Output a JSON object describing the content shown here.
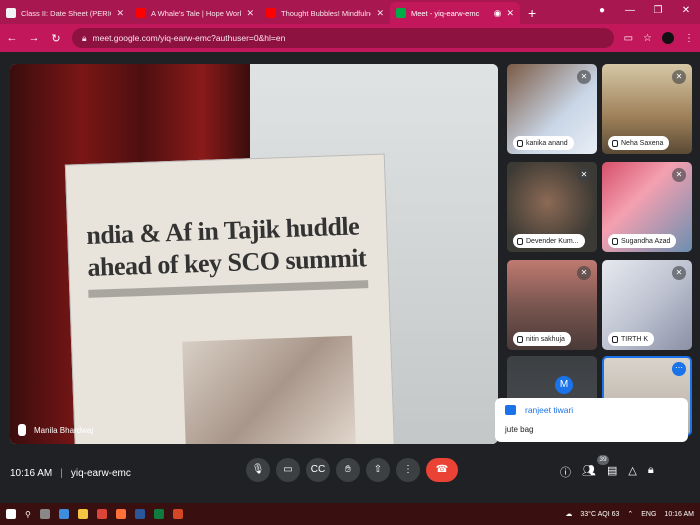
{
  "tabs": [
    {
      "title": "Class II: Date Sheet (PERIODIC TE",
      "favicon_color": "#f1f3f4"
    },
    {
      "title": "A Whale's Tale | Hope Works - Yo",
      "favicon_color": "#ff0000"
    },
    {
      "title": "Thought Bubbles! Mindfulness fo",
      "favicon_color": "#ff0000"
    },
    {
      "title": "Meet - yiq-earw-emc",
      "favicon_color": "#00ac47",
      "active": true
    }
  ],
  "address": {
    "url": "meet.google.com/yiq-earw-emc?authuser=0&hl=en"
  },
  "main_video": {
    "headline_line1": "ndia & Af in Tajik huddle",
    "headline_line2": "ahead of key SCO summit",
    "participant": "Manila Bhardwaj"
  },
  "participants": [
    {
      "name": "kanika anand"
    },
    {
      "name": "Neha Saxena"
    },
    {
      "name": "Devender Kum..."
    },
    {
      "name": "Sugandha Azad"
    },
    {
      "name": "nitin sakhuja"
    },
    {
      "name": "TIRTH K"
    }
  ],
  "avatar_letter": "M",
  "chat": {
    "sender": "ranjeet tiwari",
    "message": "jute bag"
  },
  "meeting": {
    "time": "10:16 AM",
    "code": "yiq-earw-emc",
    "participant_count": "39"
  },
  "taskbar": {
    "weather": "33°C AQI 63",
    "lang": "ENG",
    "time": "10:16 AM"
  },
  "colors": {
    "chrome": "#c2185b",
    "end_call": "#ea4335",
    "accent": "#1a73e8"
  }
}
